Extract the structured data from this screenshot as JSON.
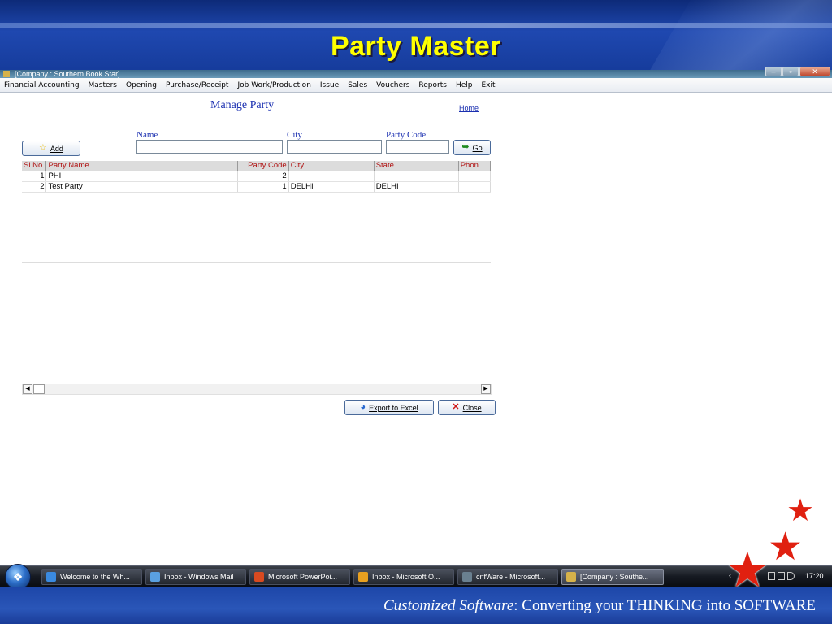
{
  "slide": {
    "title": "Party Master",
    "footer_italic": "Customized Software",
    "footer_rest": ":   Converting your THINKING into SOFTWARE"
  },
  "window": {
    "title": "[Company : Southern Book Star]"
  },
  "menu": [
    "Financial Accounting",
    "Masters",
    "Opening",
    "Purchase/Receipt",
    "Job Work/Production",
    "Issue",
    "Sales",
    "Vouchers",
    "Reports",
    "Help",
    "Exit"
  ],
  "form": {
    "heading": "Manage Party",
    "home_link": "Home",
    "add_label": "Add",
    "go_label": "Go",
    "name_label": "Name",
    "city_label": "City",
    "party_code_label": "Party Code",
    "name_value": "",
    "city_value": "",
    "party_code_value": ""
  },
  "grid": {
    "columns": [
      "Sl.No.",
      "Party Name",
      "Party Code",
      "City",
      "State",
      "Phon"
    ],
    "rows": [
      [
        "1",
        "PHI",
        "2",
        "",
        "",
        ""
      ],
      [
        "2",
        "Test Party",
        "1",
        "DELHI",
        "DELHI",
        ""
      ]
    ]
  },
  "actions": {
    "export_label": "Export to Excel",
    "close_label": "Close"
  },
  "taskbar": {
    "items": [
      "Welcome to the Wh...",
      "Inbox - Windows Mail",
      "Microsoft PowerPoi...",
      "Inbox - Microsoft O...",
      "cnfWare - Microsoft...",
      "[Company : Southe..."
    ],
    "clock": "17:20"
  },
  "colors": {
    "title_yellow": "#ffff00",
    "link_blue": "#1a2fb0",
    "grid_header_red": "#b01010",
    "star_red": "#e02010"
  }
}
